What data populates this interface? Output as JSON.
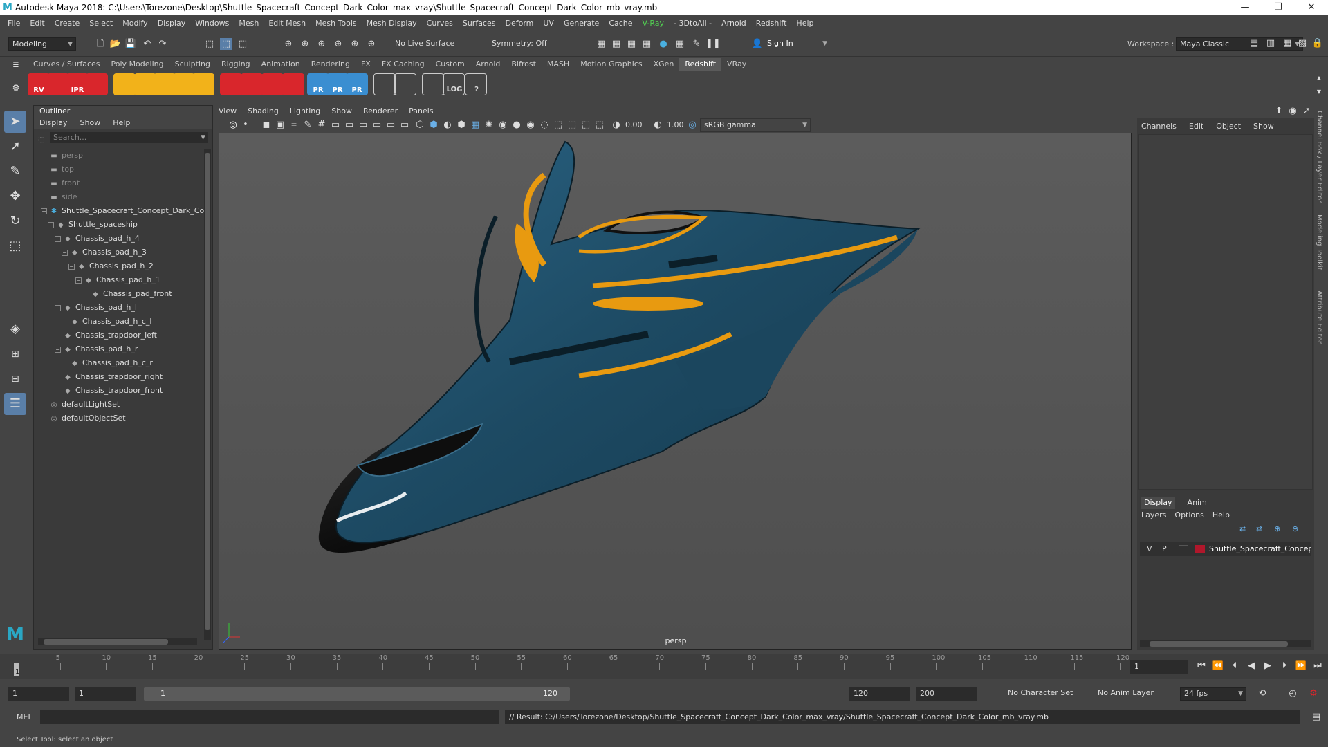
{
  "window": {
    "title": "Autodesk Maya 2018: C:\\Users\\Torezone\\Desktop\\Shuttle_Spacecraft_Concept_Dark_Color_max_vray\\Shuttle_Spacecraft_Concept_Dark_Color_mb_vray.mb",
    "logo": "M",
    "minimize": "—",
    "restore": "❐",
    "close": "✕"
  },
  "menubar": [
    "File",
    "Edit",
    "Create",
    "Select",
    "Modify",
    "Display",
    "Windows",
    "Mesh",
    "Edit Mesh",
    "Mesh Tools",
    "Mesh Display",
    "Curves",
    "Surfaces",
    "Deform",
    "UV",
    "Generate",
    "Cache",
    "V-Ray",
    "- 3DtoAll -",
    "Arnold",
    "Redshift",
    "Help"
  ],
  "statusline": {
    "mode": "Modeling",
    "live_surface": "No Live Surface",
    "symmetry": "Symmetry: Off",
    "sign_in": "Sign In",
    "workspace_label": "Workspace :",
    "workspace_value": "Maya Classic"
  },
  "shelf_tabs": [
    "Curves / Surfaces",
    "Poly Modeling",
    "Sculpting",
    "Rigging",
    "Animation",
    "Rendering",
    "FX",
    "FX Caching",
    "Custom",
    "Arnold",
    "Bifrost",
    "MASH",
    "Motion Graphics",
    "XGen",
    "Redshift",
    "VRay"
  ],
  "active_shelf": "Redshift",
  "shelf_icons": [
    {
      "name": "rs-render-view-icon",
      "label": "RV",
      "color": "#d9262c"
    },
    {
      "name": "rs-render-icon",
      "label": "",
      "color": "#d9262c"
    },
    {
      "name": "rs-ipr-icon",
      "label": "IPR",
      "color": "#d9262c"
    },
    {
      "name": "rs-render-settings-icon",
      "label": "",
      "color": "#d9262c"
    },
    {
      "name": "rs-plane-light-icon",
      "label": "",
      "color": "#f2b21a"
    },
    {
      "name": "rs-grid-light-icon",
      "label": "",
      "color": "#f2b21a"
    },
    {
      "name": "rs-spot-light-icon",
      "label": "",
      "color": "#f2b21a"
    },
    {
      "name": "rs-dome-light-icon",
      "label": "",
      "color": "#f2b21a"
    },
    {
      "name": "rs-sun-light-icon",
      "label": "",
      "color": "#f2b21a"
    },
    {
      "name": "rs-proxy-icon",
      "label": "",
      "color": "#d9262c"
    },
    {
      "name": "rs-volume-icon",
      "label": "",
      "color": "#d9262c"
    },
    {
      "name": "rs-hair-icon",
      "label": "",
      "color": "#d9262c"
    },
    {
      "name": "rs-sphere-icon",
      "label": "",
      "color": "#d9262c"
    },
    {
      "name": "rs-pr-export-icon",
      "label": "PR",
      "color": "#3a8ed1"
    },
    {
      "name": "rs-pr-import-icon",
      "label": "PR",
      "color": "#3a8ed1"
    },
    {
      "name": "rs-pr-swap-icon",
      "label": "PR",
      "color": "#3a8ed1"
    },
    {
      "name": "rs-bowl-icon",
      "label": "",
      "color": "#dddddd"
    },
    {
      "name": "rs-bowl-alt-icon",
      "label": "",
      "color": "#dddddd"
    },
    {
      "name": "rs-window-icon",
      "label": "",
      "color": "#dddddd"
    },
    {
      "name": "rs-log-icon",
      "label": "LOG",
      "color": "#dddddd"
    },
    {
      "name": "rs-help-icon",
      "label": "?",
      "color": "#dddddd"
    }
  ],
  "outliner": {
    "title": "Outliner",
    "menu": [
      "Display",
      "Show",
      "Help"
    ],
    "search_placeholder": "Search...",
    "rows": [
      {
        "label": "persp",
        "indent": 0,
        "type": "camera"
      },
      {
        "label": "top",
        "indent": 0,
        "type": "camera"
      },
      {
        "label": "front",
        "indent": 0,
        "type": "camera"
      },
      {
        "label": "side",
        "indent": 0,
        "type": "camera"
      },
      {
        "label": "Shuttle_Spacecraft_Concept_Dark_Co",
        "indent": 0,
        "type": "group",
        "toggle": "−"
      },
      {
        "label": "Shuttle_spaceship",
        "indent": 1,
        "type": "mesh",
        "toggle": "−"
      },
      {
        "label": "Chassis_pad_h_4",
        "indent": 2,
        "type": "mesh",
        "toggle": "−"
      },
      {
        "label": "Chassis_pad_h_3",
        "indent": 3,
        "type": "mesh",
        "toggle": "−"
      },
      {
        "label": "Chassis_pad_h_2",
        "indent": 4,
        "type": "mesh",
        "toggle": "−"
      },
      {
        "label": "Chassis_pad_h_1",
        "indent": 5,
        "type": "mesh",
        "toggle": "−"
      },
      {
        "label": "Chassis_pad_front",
        "indent": 6,
        "type": "mesh"
      },
      {
        "label": "Chassis_pad_h_l",
        "indent": 2,
        "type": "mesh",
        "toggle": "−"
      },
      {
        "label": "Chassis_pad_h_c_l",
        "indent": 3,
        "type": "mesh"
      },
      {
        "label": "Chassis_trapdoor_left",
        "indent": 2,
        "type": "mesh"
      },
      {
        "label": "Chassis_pad_h_r",
        "indent": 2,
        "type": "mesh",
        "toggle": "−"
      },
      {
        "label": "Chassis_pad_h_c_r",
        "indent": 3,
        "type": "mesh"
      },
      {
        "label": "Chassis_trapdoor_right",
        "indent": 2,
        "type": "mesh"
      },
      {
        "label": "Chassis_trapdoor_front",
        "indent": 2,
        "type": "mesh"
      },
      {
        "label": "defaultLightSet",
        "indent": 0,
        "type": "set"
      },
      {
        "label": "defaultObjectSet",
        "indent": 0,
        "type": "set"
      }
    ]
  },
  "viewport": {
    "menu": [
      "View",
      "Shading",
      "Lighting",
      "Show",
      "Renderer",
      "Panels"
    ],
    "exposure": "0.00",
    "gamma": "1.00",
    "color_space": "sRGB gamma",
    "camera_label": "persp"
  },
  "channel_box": {
    "menu": [
      "Channels",
      "Edit",
      "Object",
      "Show"
    ]
  },
  "layer_editor": {
    "tabs": [
      "Display",
      "Anim"
    ],
    "active_tab": "Display",
    "menu": [
      "Layers",
      "Options",
      "Help"
    ],
    "layer": {
      "v": "V",
      "p": "P",
      "name": "Shuttle_Spacecraft_Concept_D",
      "color": "#b0172b"
    }
  },
  "side_tabs": [
    "Channel Box / Layer Editor",
    "Modeling Toolkit",
    "Attribute Editor"
  ],
  "timeline": {
    "ticks": [
      "5",
      "10",
      "15",
      "20",
      "25",
      "30",
      "35",
      "40",
      "45",
      "50",
      "55",
      "60",
      "65",
      "70",
      "75",
      "80",
      "85",
      "90",
      "95",
      "100",
      "105",
      "110",
      "115",
      "120"
    ],
    "current_frame_marker": "1",
    "current_frame": "1"
  },
  "range": {
    "start": "1",
    "playback_start": "1",
    "slider_start": "1",
    "slider_end": "120",
    "playback_end": "120",
    "end": "200",
    "character_set": "No Character Set",
    "anim_layer": "No Anim Layer",
    "fps": "24 fps"
  },
  "command_line": {
    "lang": "MEL",
    "result": "// Result: C:/Users/Torezone/Desktop/Shuttle_Spacecraft_Concept_Dark_Color_max_vray/Shuttle_Spacecraft_Concept_Dark_Color_mb_vray.mb"
  },
  "help_line": "Select Tool: select an object",
  "colors": {
    "accent": "#2aa7c4",
    "hull": "#1d4a63",
    "stripe": "#e89a10",
    "layer_red": "#b0172b"
  }
}
